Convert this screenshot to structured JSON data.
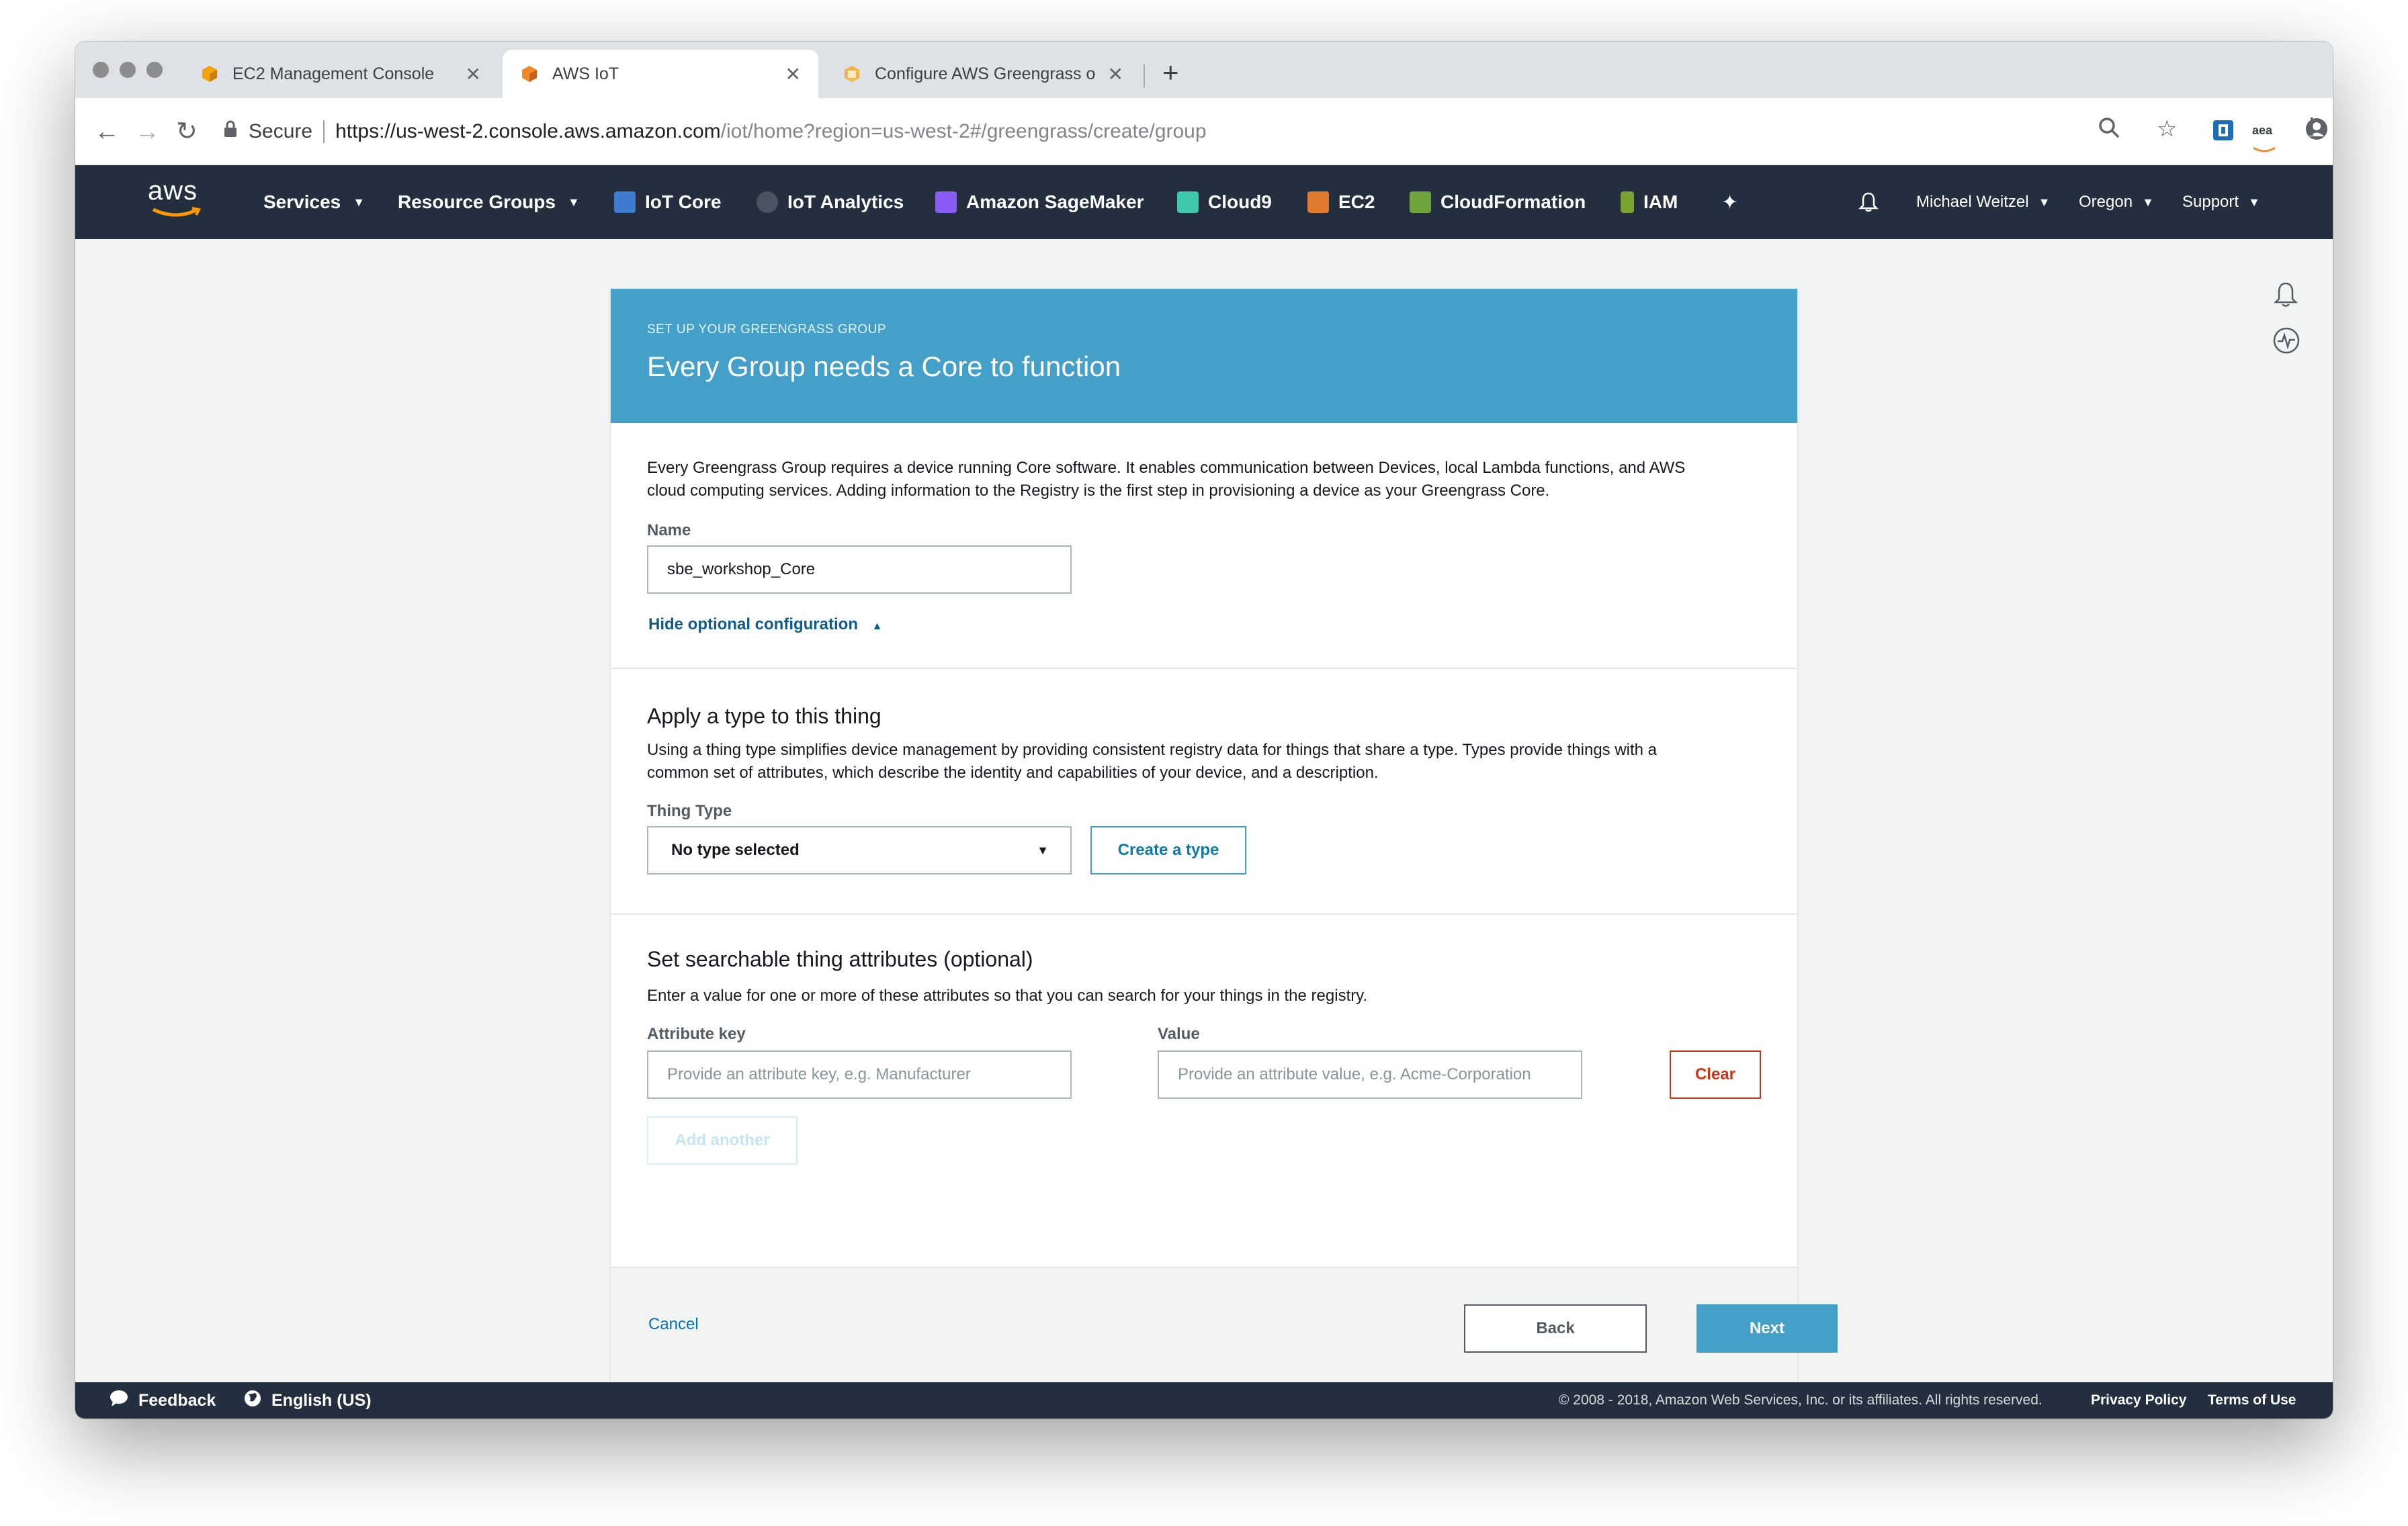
{
  "browser": {
    "tabs": [
      {
        "title": "EC2 Management Console",
        "icon": "aws-cube-icon",
        "active": false
      },
      {
        "title": "AWS IoT",
        "icon": "aws-iot-icon",
        "active": true
      },
      {
        "title": "Configure AWS Greengrass on",
        "icon": "aws-docs-icon",
        "active": false
      }
    ],
    "secure_label": "Secure",
    "url_main": "https://us-west-2.console.aws.amazon.com",
    "url_path": "/iot/home?region=us-west-2#/greengrass/create/group",
    "ext_label": "aea"
  },
  "aws_nav": {
    "logo": "aws",
    "services": "Services",
    "resource_groups": "Resource Groups",
    "shortcuts": [
      {
        "label": "IoT Core",
        "color": "#3f7bd1"
      },
      {
        "label": "IoT Analytics",
        "color": "#7f8c8d"
      },
      {
        "label": "Amazon SageMaker",
        "color": "#8a5cf5"
      },
      {
        "label": "Cloud9",
        "color": "#3ec7a9"
      },
      {
        "label": "EC2",
        "color": "#e07a2e"
      },
      {
        "label": "CloudFormation",
        "color": "#6fa33b"
      },
      {
        "label": "IAM",
        "color": "#7ba32f"
      }
    ],
    "user": "Michael Weitzel",
    "region": "Oregon",
    "support": "Support"
  },
  "header": {
    "eyebrow": "SET UP YOUR GREENGRASS GROUP",
    "title": "Every Group needs a Core to function"
  },
  "core_section": {
    "description_line1": "Every Greengrass Group requires a device running Core software. It enables communication between Devices, local Lambda functions, and AWS",
    "description_line2": "cloud computing services. Adding information to the Registry is the first step in provisioning a device as your Greengrass Core.",
    "name_label": "Name",
    "name_value": "sbe_workshop_Core",
    "optional_toggle": "Hide optional configuration"
  },
  "type_section": {
    "title": "Apply a type to this thing",
    "description_line1": "Using a thing type simplifies device management by providing consistent registry data for things that share a type. Types provide things with a",
    "description_line2": "common set of attributes, which describe the identity and capabilities of your device, and a description.",
    "thing_type_label": "Thing Type",
    "thing_type_value": "No type selected",
    "create_type_button": "Create a type"
  },
  "attributes_section": {
    "title": "Set searchable thing attributes (optional)",
    "description": "Enter a value for one or more of these attributes so that you can search for your things in the registry.",
    "key_label": "Attribute key",
    "key_placeholder": "Provide an attribute key, e.g. Manufacturer",
    "value_label": "Value",
    "value_placeholder": "Provide an attribute value, e.g. Acme-Corporation",
    "clear_button": "Clear",
    "add_another_button": "Add another"
  },
  "actions": {
    "cancel": "Cancel",
    "back": "Back",
    "next": "Next"
  },
  "footer": {
    "feedback": "Feedback",
    "language": "English (US)",
    "copyright": "© 2008 - 2018, Amazon Web Services, Inc. or its affiliates. All rights reserved.",
    "privacy": "Privacy Policy",
    "terms": "Terms of Use"
  },
  "colors": {
    "header_blue": "#44a0c9",
    "nav_dark": "#232f3e",
    "primary_button": "#44a0c9",
    "clear_red": "#d13212",
    "link_blue": "#0073bb"
  }
}
